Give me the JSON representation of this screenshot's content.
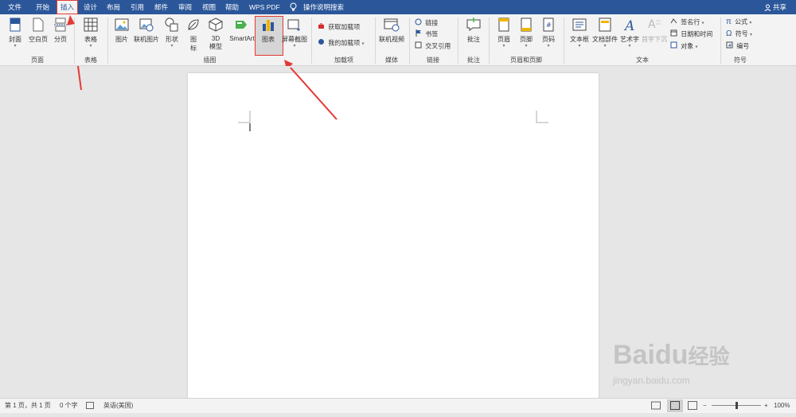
{
  "menubar": {
    "tabs": [
      "文件",
      "开始",
      "插入",
      "设计",
      "布局",
      "引用",
      "邮件",
      "审阅",
      "视图",
      "帮助",
      "WPS PDF"
    ],
    "active_tab": "插入",
    "tell_me": "操作说明搜索",
    "share": "共享"
  },
  "ribbon": {
    "pages": {
      "cover": "封面",
      "blank": "空白页",
      "break": "分页",
      "group": "页面"
    },
    "tables": {
      "table": "表格",
      "group": "表格"
    },
    "illustrations": {
      "picture": "图片",
      "online_picture": "联机图片",
      "shapes": "形状",
      "icons_line1": "图",
      "icons_line2": "标",
      "model_line1": "3D",
      "model_line2": "模型",
      "smartart": "SmartArt",
      "chart": "图表",
      "screenshot": "屏幕截图",
      "group": "插图"
    },
    "addins": {
      "get": "获取加载项",
      "mine": "我的加载项",
      "group": "加载项"
    },
    "media": {
      "video": "联机视频",
      "group": "媒体"
    },
    "links": {
      "link": "链接",
      "bookmark": "书签",
      "cross_ref": "交叉引用",
      "group": "链接"
    },
    "comments": {
      "comment": "批注",
      "group": "批注"
    },
    "header_footer": {
      "header": "页眉",
      "footer": "页脚",
      "page_number": "页码",
      "group": "页眉和页脚"
    },
    "text": {
      "textbox": "文本框",
      "quick_parts": "文档部件",
      "wordart": "艺术字",
      "dropcap": "首字下沉",
      "signature": "签名行",
      "datetime": "日期和时间",
      "object": "对象",
      "group": "文本"
    },
    "symbols": {
      "equation": "公式",
      "symbol": "符号",
      "number": "编号",
      "group": "符号"
    }
  },
  "status": {
    "page": "第 1 页，共 1 页",
    "words": "0 个字",
    "language": "英语(美国)",
    "zoom": "100%"
  },
  "watermark": {
    "brand": "Baidu",
    "brand_cn": "经验",
    "url": "jingyan.baidu.com"
  },
  "colors": {
    "accent": "#2b579a",
    "annotation": "#e53935"
  }
}
